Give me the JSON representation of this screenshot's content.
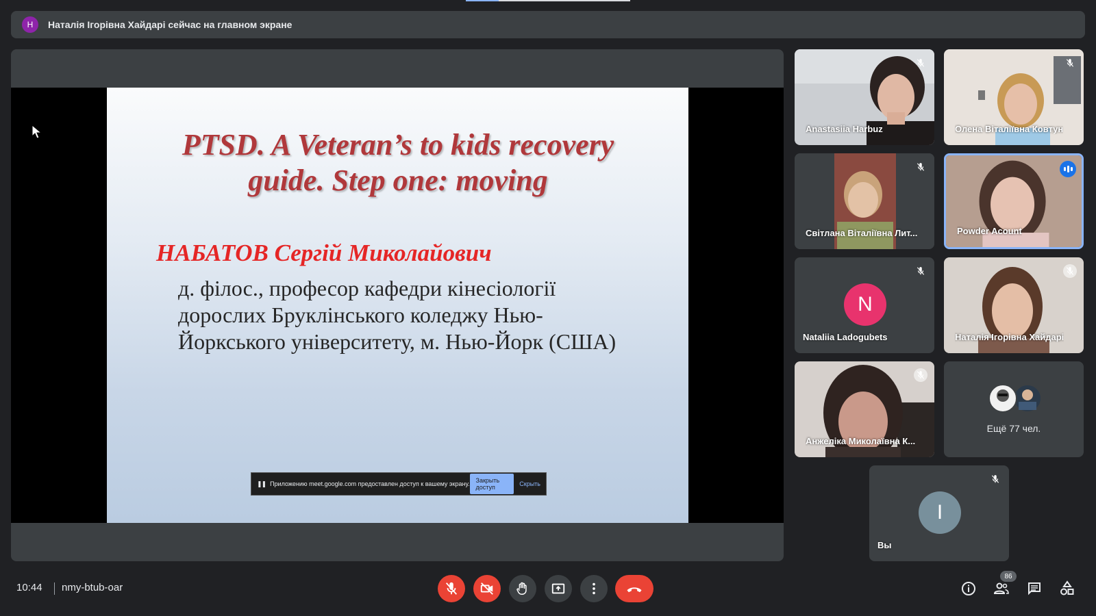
{
  "banner": {
    "avatar_letter": "Н",
    "avatar_color": "#8e24aa",
    "text": "Наталія Ігорівна Хайдарі сейчас на главном экране"
  },
  "slide": {
    "title": "PTSD. A Veteran’s to kids recovery guide. Step one: moving",
    "author": "НАБАТОВ Сергій Миколайович",
    "affiliation": "д. філос., професор кафедри кінесіології дорослих Бруклінського коледжу Нью-Йоркського університету, м. Нью-Йорк (США)"
  },
  "share_bar": {
    "message": "Приложению meet.google.com предоставлен доступ к вашему экрану.",
    "stop_label": "Закрыть доступ",
    "hide_label": "Скрыть"
  },
  "participants": [
    {
      "name": "Anastasiia Harbuz",
      "muted": true,
      "video": true
    },
    {
      "name": "Олена Віталіївна Ковтун",
      "muted": true,
      "video": true
    },
    {
      "name": "Світлана Віталіївна Лит...",
      "muted": true,
      "video": true
    },
    {
      "name": "Powder Acount",
      "muted": false,
      "speaking": true,
      "video": true
    },
    {
      "name": "Nataliia Ladogubets",
      "muted": true,
      "video": false,
      "avatar_letter": "N",
      "avatar_color": "#e8336d"
    },
    {
      "name": "Наталія Ігорівна Хайдарі",
      "muted": true,
      "video": true
    },
    {
      "name": "Анжеліка Миколаївна К...",
      "muted": true,
      "video": true
    }
  ],
  "more_tile": {
    "text": "Ещё 77 чел."
  },
  "self_tile": {
    "name": "Вы",
    "avatar_letter": "I",
    "avatar_color": "#78909c",
    "muted": true
  },
  "bottom": {
    "time": "10:44",
    "meeting_code": "nmy-btub-oar",
    "people_count": "86"
  },
  "colors": {
    "danger": "#ea4335",
    "accent": "#8ab4f8",
    "surface": "#3c4043",
    "background": "#202124"
  },
  "icons": [
    "mic-off-icon",
    "camera-off-icon",
    "raise-hand-icon",
    "present-screen-icon",
    "more-options-icon",
    "end-call-icon",
    "info-icon",
    "people-icon",
    "chat-icon",
    "activities-icon"
  ]
}
